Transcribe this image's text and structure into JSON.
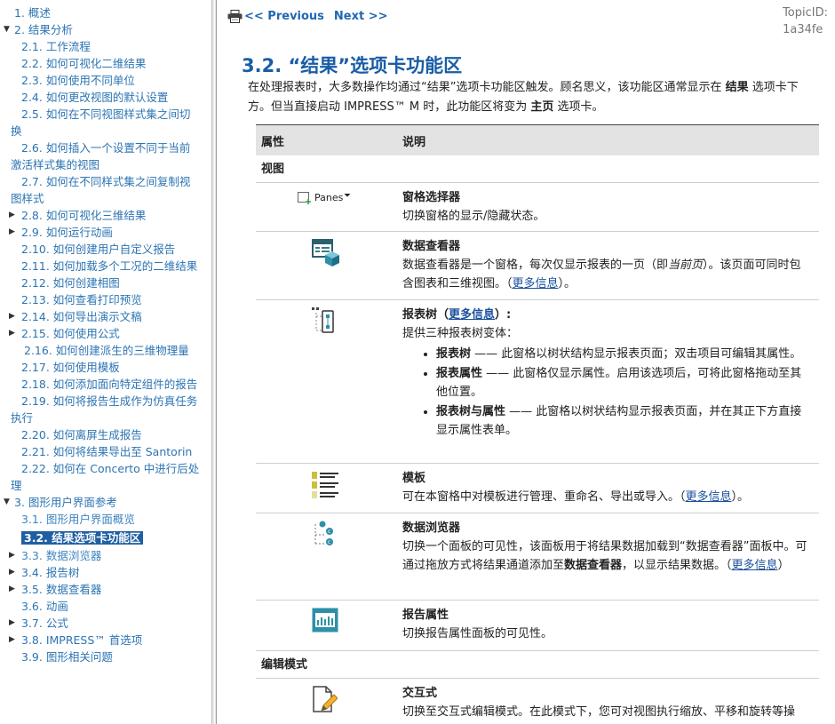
{
  "toc": [
    {
      "label": "1. 概述",
      "indent": 16,
      "arrow": ""
    },
    {
      "label": "2. 结果分析",
      "indent": 16,
      "arrow": "▼"
    },
    {
      "label": "2.1. 工作流程",
      "indent": 24,
      "arrow": ""
    },
    {
      "label": "2.2. 如何可视化二维结果",
      "indent": 24,
      "arrow": ""
    },
    {
      "label": "2.3. 如何使用不同单位",
      "indent": 24,
      "arrow": ""
    },
    {
      "label": "2.4. 如何更改视图的默认设置",
      "indent": 24,
      "arrow": ""
    },
    {
      "label": "2.5. 如何在不同视图样式集之间切",
      "indent": 24,
      "arrow": ""
    },
    {
      "label": "换",
      "indent": 12,
      "arrow": ""
    },
    {
      "label": "2.6. 如何插入一个设置不同于当前",
      "indent": 24,
      "arrow": ""
    },
    {
      "label": "激活样式集的视图",
      "indent": 12,
      "arrow": ""
    },
    {
      "label": "2.7. 如何在不同样式集之间复制视",
      "indent": 24,
      "arrow": ""
    },
    {
      "label": "图样式",
      "indent": 12,
      "arrow": ""
    },
    {
      "label": "2.8. 如何可视化三维结果",
      "indent": 24,
      "arrow": "▶"
    },
    {
      "label": "2.9. 如何运行动画",
      "indent": 24,
      "arrow": "▶"
    },
    {
      "label": "2.10. 如何创建用户自定义报告",
      "indent": 24,
      "arrow": ""
    },
    {
      "label": "2.11. 如何加载多个工况的二维结果",
      "indent": 24,
      "arrow": ""
    },
    {
      "label": "2.12. 如何创建相图",
      "indent": 24,
      "arrow": ""
    },
    {
      "label": "2.13. 如何查看打印预览",
      "indent": 24,
      "arrow": ""
    },
    {
      "label": "2.14. 如何导出演示文稿",
      "indent": 24,
      "arrow": "▶"
    },
    {
      "label": "2.15. 如何使用公式",
      "indent": 24,
      "arrow": "▶"
    },
    {
      "label": "2.16. 如何创建派生的三维物理量",
      "indent": 27,
      "arrow": ""
    },
    {
      "label": "2.17. 如何使用模板",
      "indent": 24,
      "arrow": ""
    },
    {
      "label": "2.18. 如何添加面向特定组件的报告",
      "indent": 24,
      "arrow": ""
    },
    {
      "label": "2.19. 如何将报告生成作为仿真任务",
      "indent": 24,
      "arrow": ""
    },
    {
      "label": "执行",
      "indent": 12,
      "arrow": ""
    },
    {
      "label": "2.20. 如何离屏生成报告",
      "indent": 24,
      "arrow": ""
    },
    {
      "label": "2.21. 如何将结果导出至 Santorin",
      "indent": 24,
      "arrow": ""
    },
    {
      "label": "2.22. 如何在 Concerto 中进行后处",
      "indent": 24,
      "arrow": ""
    },
    {
      "label": "理",
      "indent": 12,
      "arrow": ""
    },
    {
      "label": "3. 图形用户界面参考",
      "indent": 16,
      "arrow": "▼"
    },
    {
      "label": "3.1. 图形用户界面概览",
      "indent": 24,
      "arrow": "",
      "muted": true
    },
    {
      "label": "3.2. 结果选项卡功能区",
      "indent": 24,
      "arrow": "",
      "current": true
    },
    {
      "label": "3.3. 数据浏览器",
      "indent": 24,
      "arrow": "▶",
      "muted": true
    },
    {
      "label": "3.4. 报告树",
      "indent": 24,
      "arrow": "▶"
    },
    {
      "label": "3.5. 数据查看器",
      "indent": 24,
      "arrow": "▶"
    },
    {
      "label": "3.6. 动画",
      "indent": 24,
      "arrow": ""
    },
    {
      "label": "3.7. 公式",
      "indent": 24,
      "arrow": "▶"
    },
    {
      "label": "3.8. IMPRESS™ 首选项",
      "indent": 24,
      "arrow": "▶"
    },
    {
      "label": "3.9. 图形相关问题",
      "indent": 24,
      "arrow": ""
    }
  ],
  "nav": {
    "previous": "<< Previous",
    "next": "Next >>"
  },
  "topic": {
    "label": "TopicID:",
    "value": "1a34fe"
  },
  "page": {
    "title": "3.2. “结果”选项卡功能区",
    "intro": [
      {
        "t": "在处理报表时，大多数操作均通过“结果”选项卡功能区触发。顾名思义，该功能区通常显示在 "
      },
      {
        "t": "结果",
        "b": true
      },
      {
        "t": " 选项卡下方。但当直接启动 IMPRESS™ M 时，此功能区将变为 "
      },
      {
        "t": "主页",
        "b": true
      },
      {
        "t": " 选项卡。"
      }
    ]
  },
  "table": {
    "col_property": "属性",
    "col_description": "说明",
    "section_view": "视图",
    "section_edit": "编辑模式",
    "panes_label": "Panes",
    "rows": {
      "panes": {
        "name": "窗格选择器",
        "text": "切换窗格的显示/隐藏状态。"
      },
      "viewer": {
        "name": "数据查看器",
        "parts": [
          {
            "t": "数据查看器是一个窗格，每次仅显示报表的一页（即"
          },
          {
            "t": "当前页",
            "i": true
          },
          {
            "t": "）。该页面可同时包含图表和三维视图。（"
          },
          {
            "t": "更多信息",
            "a": true
          },
          {
            "t": "）。"
          }
        ]
      },
      "tree": {
        "name": "报表树",
        "name_open": "（",
        "name_link": "更多信息",
        "name_close": "）:",
        "text": "提供三种报表树变体：",
        "bullets": [
          {
            "b": "报表树",
            "t": " —— 此窗格以树状结构显示报表页面；双击项目可编辑其属性。"
          },
          {
            "b": "报表属性",
            "t": " —— 此窗格仅显示属性。启用该选项后，可将此窗格拖动至其他位置。"
          },
          {
            "b": "报表树与属性",
            "t": " —— 此窗格以树状结构显示报表页面，并在其正下方直接显示属性表单。"
          }
        ]
      },
      "template": {
        "name": "模板",
        "parts": [
          {
            "t": "可在本窗格中对模板进行管理、重命名、导出或导入。（"
          },
          {
            "t": "更多信息",
            "a": true
          },
          {
            "t": "）。"
          }
        ]
      },
      "browser": {
        "name": "数据浏览器",
        "parts": [
          {
            "t": "切换一个面板的可见性，该面板用于将结果数据加载到“数据查看器”面板中。可通过拖放方式将结果通道添加至"
          },
          {
            "t": "数据查看器",
            "b": true
          },
          {
            "t": "，以显示结果数据。（"
          },
          {
            "t": "更多信息",
            "a": true
          },
          {
            "t": "）"
          }
        ]
      },
      "report_props": {
        "name": "报告属性",
        "text": "切换报告属性面板的可见性。"
      },
      "interactive": {
        "name": "交互式",
        "text": "切换至交互式编辑模式。在此模式下，您可对视图执行缩放、平移和旋转等操作，同时也可选中"
      }
    }
  },
  "colors": {
    "link": "#2c74b3",
    "heading": "#1a5da6",
    "current_bg": "#1f5fa3",
    "header_bg": "#e3e3e3"
  }
}
